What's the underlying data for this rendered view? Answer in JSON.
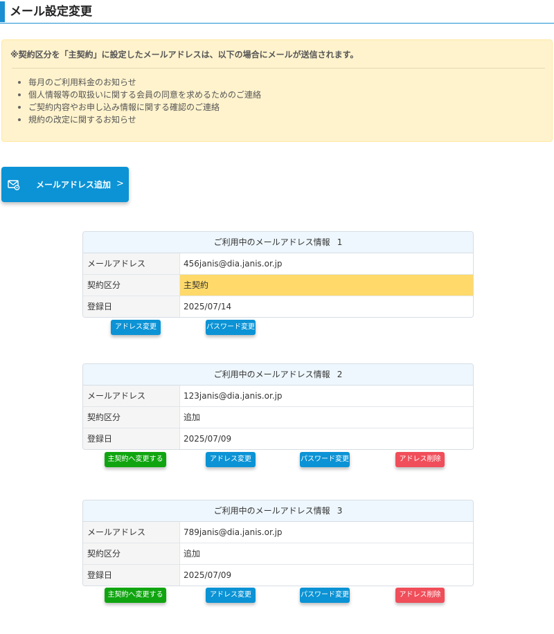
{
  "header": {
    "title": "メール設定変更"
  },
  "notice": {
    "text": "※契約区分を「主契約」に設定したメールアドレスは、以下の場合にメールが送信されます。",
    "items": [
      "毎月のご利用料金のお知らせ",
      "個人情報等の取扱いに関する会員の同意を求めるためのご連絡",
      "ご契約内容やお申し込み情報に関する確認のご連絡",
      "規約の改定に関するお知らせ"
    ]
  },
  "add_button": {
    "label": "メールアドレス追加",
    "chevron": ">",
    "icon": "mail-settings-icon"
  },
  "cards": [
    {
      "title": "ご利用中のメールアドレス情報",
      "number": "1",
      "labels": {
        "email": "メールアドレス",
        "contract": "契約区分",
        "registered": "登録日"
      },
      "email": "456janis@dia.janis.or.jp",
      "contract": "主契約",
      "registered": "2025/07/14",
      "buttons": {
        "change_address": "アドレス変更",
        "change_password": "パスワード変更"
      }
    },
    {
      "title": "ご利用中のメールアドレス情報",
      "number": "2",
      "labels": {
        "email": "メールアドレス",
        "contract": "契約区分",
        "registered": "登録日"
      },
      "email": "123janis@dia.janis.or.jp",
      "contract": "追加",
      "registered": "2025/07/09",
      "buttons": {
        "make_primary": "主契約へ変更する",
        "change_address": "アドレス変更",
        "change_password": "パスワード変更",
        "delete_address": "アドレス削除"
      }
    },
    {
      "title": "ご利用中のメールアドレス情報",
      "number": "3",
      "labels": {
        "email": "メールアドレス",
        "contract": "契約区分",
        "registered": "登録日"
      },
      "email": "789janis@dia.janis.or.jp",
      "contract": "追加",
      "registered": "2025/07/09",
      "buttons": {
        "make_primary": "主契約へ変更する",
        "change_address": "アドレス変更",
        "change_password": "パスワード変更",
        "delete_address": "アドレス削除"
      }
    }
  ],
  "colors": {
    "accent": "#0b93d5",
    "notice_bg": "#fff3cd",
    "primary_highlight": "#ffda6a",
    "green": "#10a510",
    "red": "#f04e5a"
  }
}
